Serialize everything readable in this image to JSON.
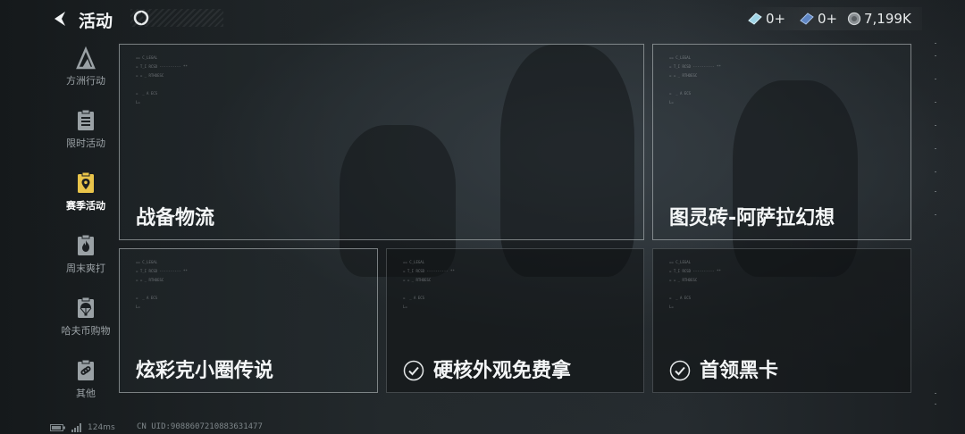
{
  "header": {
    "title": "活动"
  },
  "currencies": [
    {
      "icon": "ticket-icon",
      "value": "0+"
    },
    {
      "icon": "blue-ticket-icon",
      "value": "0+"
    },
    {
      "icon": "coin-icon",
      "value": "7,199K"
    }
  ],
  "sidebar": {
    "items": [
      {
        "label": "方洲行动",
        "icon": "mountain-logo-icon",
        "active": false
      },
      {
        "label": "限时活动",
        "icon": "clipboard-list-icon",
        "active": false
      },
      {
        "label": "赛季活动",
        "icon": "map-pin-icon",
        "active": true
      },
      {
        "label": "周末爽打",
        "icon": "flame-icon",
        "active": false
      },
      {
        "label": "哈夫币购物",
        "icon": "parachute-icon",
        "active": false
      },
      {
        "label": "其他",
        "icon": "link-icon",
        "active": false
      }
    ]
  },
  "cards": [
    {
      "name": "战备物流",
      "checked": false
    },
    {
      "name": "图灵砖-阿萨拉幻想",
      "checked": false
    },
    {
      "name": "炫彩克小圈传说",
      "checked": false
    },
    {
      "name": "硬核外观免费拿",
      "checked": true
    },
    {
      "name": "首领黑卡",
      "checked": true
    }
  ],
  "footer": {
    "ping": "124ms",
    "uid": "CN UID:9088607210883631477"
  },
  "colors": {
    "accent": "#e9c44a",
    "card_border": "#c8cdd0"
  }
}
